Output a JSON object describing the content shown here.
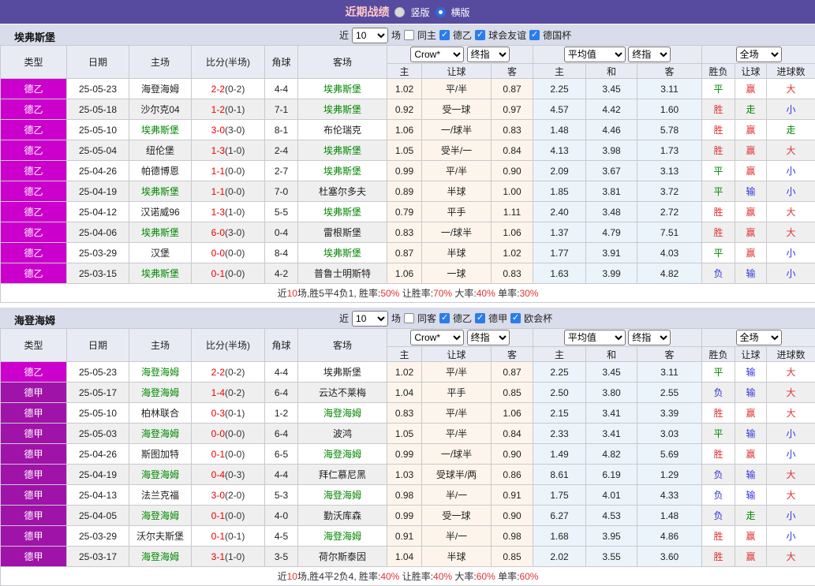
{
  "title_bar": {
    "title": "近期战绩",
    "radios": [
      {
        "label": "竖版",
        "checked": false
      },
      {
        "label": "横版",
        "checked": true
      }
    ]
  },
  "labels": {
    "near": "近",
    "games": "场"
  },
  "hdr": {
    "left": [
      "类型",
      "日期",
      "主场",
      "比分(半场)",
      "角球",
      "客场"
    ],
    "sub": [
      "主",
      "让球",
      "客",
      "主",
      "和",
      "客",
      "胜负",
      "让球",
      "进球数"
    ],
    "selects": {
      "book": "Crow*",
      "fin1": "终指",
      "avg": "平均值",
      "fin2": "终指",
      "scope": "全场"
    }
  },
  "colors": {
    "topbar_purple": "#574B9F",
    "title_pink": "#FFC8C8",
    "league_de2_magenta": "#CC00CC",
    "league_de1_purple": "#A013A8",
    "focus_team_green": "#008800",
    "score_red": "#EE0000",
    "win_red": "#E13232",
    "draw_green": "#008800",
    "lose_blue": "#3434DE",
    "odds_bg_cream": "#FDF5EB",
    "avg_bg_blue": "#EBF4FA"
  },
  "sections": [
    {
      "team": "埃弗斯堡",
      "filter": {
        "games": "10",
        "same_label": "同主",
        "same_checked": false,
        "leagues": [
          {
            "label": "德乙",
            "checked": true
          },
          {
            "label": "球会友谊",
            "checked": true
          },
          {
            "label": "德国杯",
            "checked": true
          }
        ]
      },
      "rows": [
        {
          "lg": "德乙",
          "lc": "a",
          "d": "25-05-23",
          "h": "海登海姆",
          "hf": false,
          "s": "2-2",
          "hs": "(0-2)",
          "c": "4-4",
          "a": "埃弗斯堡",
          "af": true,
          "o": [
            "1.02",
            "平/半",
            "0.87"
          ],
          "m": [
            "2.25",
            "3.45",
            "3.11"
          ],
          "res": [
            [
              "平",
              "g"
            ],
            [
              "赢",
              "r"
            ],
            [
              "大",
              "r"
            ]
          ]
        },
        {
          "lg": "德乙",
          "lc": "a",
          "d": "25-05-18",
          "h": "沙尔克04",
          "hf": false,
          "s": "1-2",
          "hs": "(0-1)",
          "c": "7-1",
          "a": "埃弗斯堡",
          "af": true,
          "o": [
            "0.92",
            "受一球",
            "0.97"
          ],
          "m": [
            "4.57",
            "4.42",
            "1.60"
          ],
          "res": [
            [
              "胜",
              "r"
            ],
            [
              "走",
              "g"
            ],
            [
              "小",
              "b"
            ]
          ]
        },
        {
          "lg": "德乙",
          "lc": "a",
          "d": "25-05-10",
          "h": "埃弗斯堡",
          "hf": true,
          "s": "3-0",
          "hs": "(3-0)",
          "c": "8-1",
          "a": "布伦瑞克",
          "af": false,
          "o": [
            "1.06",
            "一/球半",
            "0.83"
          ],
          "m": [
            "1.48",
            "4.46",
            "5.78"
          ],
          "res": [
            [
              "胜",
              "r"
            ],
            [
              "赢",
              "r"
            ],
            [
              "走",
              "g"
            ]
          ]
        },
        {
          "lg": "德乙",
          "lc": "a",
          "d": "25-05-04",
          "h": "纽伦堡",
          "hf": false,
          "s": "1-3",
          "hs": "(1-0)",
          "c": "2-4",
          "a": "埃弗斯堡",
          "af": true,
          "o": [
            "1.05",
            "受半/一",
            "0.84"
          ],
          "m": [
            "4.13",
            "3.98",
            "1.73"
          ],
          "res": [
            [
              "胜",
              "r"
            ],
            [
              "赢",
              "r"
            ],
            [
              "大",
              "r"
            ]
          ]
        },
        {
          "lg": "德乙",
          "lc": "a",
          "d": "25-04-26",
          "h": "帕德博恩",
          "hf": false,
          "s": "1-1",
          "hs": "(0-0)",
          "c": "2-7",
          "a": "埃弗斯堡",
          "af": true,
          "o": [
            "0.99",
            "平/半",
            "0.90"
          ],
          "m": [
            "2.09",
            "3.67",
            "3.13"
          ],
          "res": [
            [
              "平",
              "g"
            ],
            [
              "赢",
              "r"
            ],
            [
              "小",
              "b"
            ]
          ]
        },
        {
          "lg": "德乙",
          "lc": "a",
          "d": "25-04-19",
          "h": "埃弗斯堡",
          "hf": true,
          "s": "1-1",
          "hs": "(0-0)",
          "c": "7-0",
          "a": "杜塞尔多夫",
          "af": false,
          "o": [
            "0.89",
            "半球",
            "1.00"
          ],
          "m": [
            "1.85",
            "3.81",
            "3.72"
          ],
          "res": [
            [
              "平",
              "g"
            ],
            [
              "输",
              "b"
            ],
            [
              "小",
              "b"
            ]
          ]
        },
        {
          "lg": "德乙",
          "lc": "a",
          "d": "25-04-12",
          "h": "汉诺威96",
          "hf": false,
          "s": "1-3",
          "hs": "(1-0)",
          "c": "5-5",
          "a": "埃弗斯堡",
          "af": true,
          "o": [
            "0.79",
            "平手",
            "1.11"
          ],
          "m": [
            "2.40",
            "3.48",
            "2.72"
          ],
          "res": [
            [
              "胜",
              "r"
            ],
            [
              "赢",
              "r"
            ],
            [
              "大",
              "r"
            ]
          ]
        },
        {
          "lg": "德乙",
          "lc": "a",
          "d": "25-04-06",
          "h": "埃弗斯堡",
          "hf": true,
          "s": "6-0",
          "hs": "(3-0)",
          "c": "0-4",
          "a": "雷根斯堡",
          "af": false,
          "o": [
            "0.83",
            "一/球半",
            "1.06"
          ],
          "m": [
            "1.37",
            "4.79",
            "7.51"
          ],
          "res": [
            [
              "胜",
              "r"
            ],
            [
              "赢",
              "r"
            ],
            [
              "大",
              "r"
            ]
          ]
        },
        {
          "lg": "德乙",
          "lc": "a",
          "d": "25-03-29",
          "h": "汉堡",
          "hf": false,
          "s": "0-0",
          "hs": "(0-0)",
          "c": "8-4",
          "a": "埃弗斯堡",
          "af": true,
          "o": [
            "0.87",
            "半球",
            "1.02"
          ],
          "m": [
            "1.77",
            "3.91",
            "4.03"
          ],
          "res": [
            [
              "平",
              "g"
            ],
            [
              "赢",
              "r"
            ],
            [
              "小",
              "b"
            ]
          ]
        },
        {
          "lg": "德乙",
          "lc": "a",
          "d": "25-03-15",
          "h": "埃弗斯堡",
          "hf": true,
          "s": "0-1",
          "hs": "(0-0)",
          "c": "4-2",
          "a": "普鲁士明斯特",
          "af": false,
          "o": [
            "1.06",
            "一球",
            "0.83"
          ],
          "m": [
            "1.63",
            "3.99",
            "4.82"
          ],
          "res": [
            [
              "负",
              "b"
            ],
            [
              "输",
              "b"
            ],
            [
              "小",
              "b"
            ]
          ]
        }
      ],
      "summary": [
        {
          "t": "近",
          "r": 0
        },
        {
          "t": "10",
          "r": 1
        },
        {
          "t": "场,胜5平4负1, 胜率:",
          "r": 0
        },
        {
          "t": "50%",
          "r": 1
        },
        {
          "t": " 让胜率:",
          "r": 0
        },
        {
          "t": "70%",
          "r": 1
        },
        {
          "t": " 大率:",
          "r": 0
        },
        {
          "t": "40%",
          "r": 1
        },
        {
          "t": " 单率:",
          "r": 0
        },
        {
          "t": "30%",
          "r": 1
        }
      ]
    },
    {
      "team": "海登海姆",
      "filter": {
        "games": "10",
        "same_label": "同客",
        "same_checked": false,
        "leagues": [
          {
            "label": "德乙",
            "checked": true
          },
          {
            "label": "德甲",
            "checked": true
          },
          {
            "label": "欧会杯",
            "checked": true
          }
        ]
      },
      "rows": [
        {
          "lg": "德乙",
          "lc": "a",
          "d": "25-05-23",
          "h": "海登海姆",
          "hf": true,
          "s": "2-2",
          "hs": "(0-2)",
          "c": "4-4",
          "a": "埃弗斯堡",
          "af": false,
          "o": [
            "1.02",
            "平/半",
            "0.87"
          ],
          "m": [
            "2.25",
            "3.45",
            "3.11"
          ],
          "res": [
            [
              "平",
              "g"
            ],
            [
              "输",
              "b"
            ],
            [
              "大",
              "r"
            ]
          ]
        },
        {
          "lg": "德甲",
          "lc": "b",
          "d": "25-05-17",
          "h": "海登海姆",
          "hf": true,
          "s": "1-4",
          "hs": "(0-2)",
          "c": "6-4",
          "a": "云达不莱梅",
          "af": false,
          "o": [
            "1.04",
            "平手",
            "0.85"
          ],
          "m": [
            "2.50",
            "3.80",
            "2.55"
          ],
          "res": [
            [
              "负",
              "b"
            ],
            [
              "输",
              "b"
            ],
            [
              "大",
              "r"
            ]
          ]
        },
        {
          "lg": "德甲",
          "lc": "b",
          "d": "25-05-10",
          "h": "柏林联合",
          "hf": false,
          "s": "0-3",
          "hs": "(0-1)",
          "c": "1-2",
          "a": "海登海姆",
          "af": true,
          "o": [
            "0.83",
            "平/半",
            "1.06"
          ],
          "m": [
            "2.15",
            "3.41",
            "3.39"
          ],
          "res": [
            [
              "胜",
              "r"
            ],
            [
              "赢",
              "r"
            ],
            [
              "大",
              "r"
            ]
          ]
        },
        {
          "lg": "德甲",
          "lc": "b",
          "d": "25-05-03",
          "h": "海登海姆",
          "hf": true,
          "s": "0-0",
          "hs": "(0-0)",
          "c": "6-4",
          "a": "波鸿",
          "af": false,
          "o": [
            "1.05",
            "平/半",
            "0.84"
          ],
          "m": [
            "2.33",
            "3.41",
            "3.03"
          ],
          "res": [
            [
              "平",
              "g"
            ],
            [
              "输",
              "b"
            ],
            [
              "小",
              "b"
            ]
          ]
        },
        {
          "lg": "德甲",
          "lc": "b",
          "d": "25-04-26",
          "h": "斯图加特",
          "hf": false,
          "s": "0-1",
          "hs": "(0-0)",
          "c": "6-5",
          "a": "海登海姆",
          "af": true,
          "o": [
            "0.99",
            "一/球半",
            "0.90"
          ],
          "m": [
            "1.49",
            "4.82",
            "5.69"
          ],
          "res": [
            [
              "胜",
              "r"
            ],
            [
              "赢",
              "r"
            ],
            [
              "小",
              "b"
            ]
          ]
        },
        {
          "lg": "德甲",
          "lc": "b",
          "d": "25-04-19",
          "h": "海登海姆",
          "hf": true,
          "s": "0-4",
          "hs": "(0-3)",
          "c": "4-4",
          "a": "拜仁慕尼黑",
          "af": false,
          "o": [
            "1.03",
            "受球半/两",
            "0.86"
          ],
          "m": [
            "8.61",
            "6.19",
            "1.29"
          ],
          "res": [
            [
              "负",
              "b"
            ],
            [
              "输",
              "b"
            ],
            [
              "大",
              "r"
            ]
          ]
        },
        {
          "lg": "德甲",
          "lc": "b",
          "d": "25-04-13",
          "h": "法兰克福",
          "hf": false,
          "s": "3-0",
          "hs": "(2-0)",
          "c": "5-3",
          "a": "海登海姆",
          "af": true,
          "o": [
            "0.98",
            "半/一",
            "0.91"
          ],
          "m": [
            "1.75",
            "4.01",
            "4.33"
          ],
          "res": [
            [
              "负",
              "b"
            ],
            [
              "输",
              "b"
            ],
            [
              "大",
              "r"
            ]
          ]
        },
        {
          "lg": "德甲",
          "lc": "b",
          "d": "25-04-05",
          "h": "海登海姆",
          "hf": true,
          "s": "0-1",
          "hs": "(0-0)",
          "c": "4-0",
          "a": "勤沃库森",
          "af": false,
          "o": [
            "0.99",
            "受一球",
            "0.90"
          ],
          "m": [
            "6.27",
            "4.53",
            "1.48"
          ],
          "res": [
            [
              "负",
              "b"
            ],
            [
              "走",
              "g"
            ],
            [
              "小",
              "b"
            ]
          ]
        },
        {
          "lg": "德甲",
          "lc": "b",
          "d": "25-03-29",
          "h": "沃尔夫斯堡",
          "hf": false,
          "s": "0-1",
          "hs": "(0-1)",
          "c": "4-5",
          "a": "海登海姆",
          "af": true,
          "o": [
            "0.91",
            "半/一",
            "0.98"
          ],
          "m": [
            "1.68",
            "3.95",
            "4.86"
          ],
          "res": [
            [
              "胜",
              "r"
            ],
            [
              "赢",
              "r"
            ],
            [
              "小",
              "b"
            ]
          ]
        },
        {
          "lg": "德甲",
          "lc": "b",
          "d": "25-03-17",
          "h": "海登海姆",
          "hf": true,
          "s": "3-1",
          "hs": "(1-0)",
          "c": "3-5",
          "a": "荷尔斯泰因",
          "af": false,
          "o": [
            "1.04",
            "半球",
            "0.85"
          ],
          "m": [
            "2.02",
            "3.55",
            "3.60"
          ],
          "res": [
            [
              "胜",
              "r"
            ],
            [
              "赢",
              "r"
            ],
            [
              "大",
              "r"
            ]
          ]
        }
      ],
      "summary": [
        {
          "t": "近",
          "r": 0
        },
        {
          "t": "10",
          "r": 1
        },
        {
          "t": "场,胜4平2负4, 胜率:",
          "r": 0
        },
        {
          "t": "40%",
          "r": 1
        },
        {
          "t": " 让胜率:",
          "r": 0
        },
        {
          "t": "40%",
          "r": 1
        },
        {
          "t": " 大率:",
          "r": 0
        },
        {
          "t": "60%",
          "r": 1
        },
        {
          "t": " 单率:",
          "r": 0
        },
        {
          "t": "60%",
          "r": 1
        }
      ]
    }
  ]
}
